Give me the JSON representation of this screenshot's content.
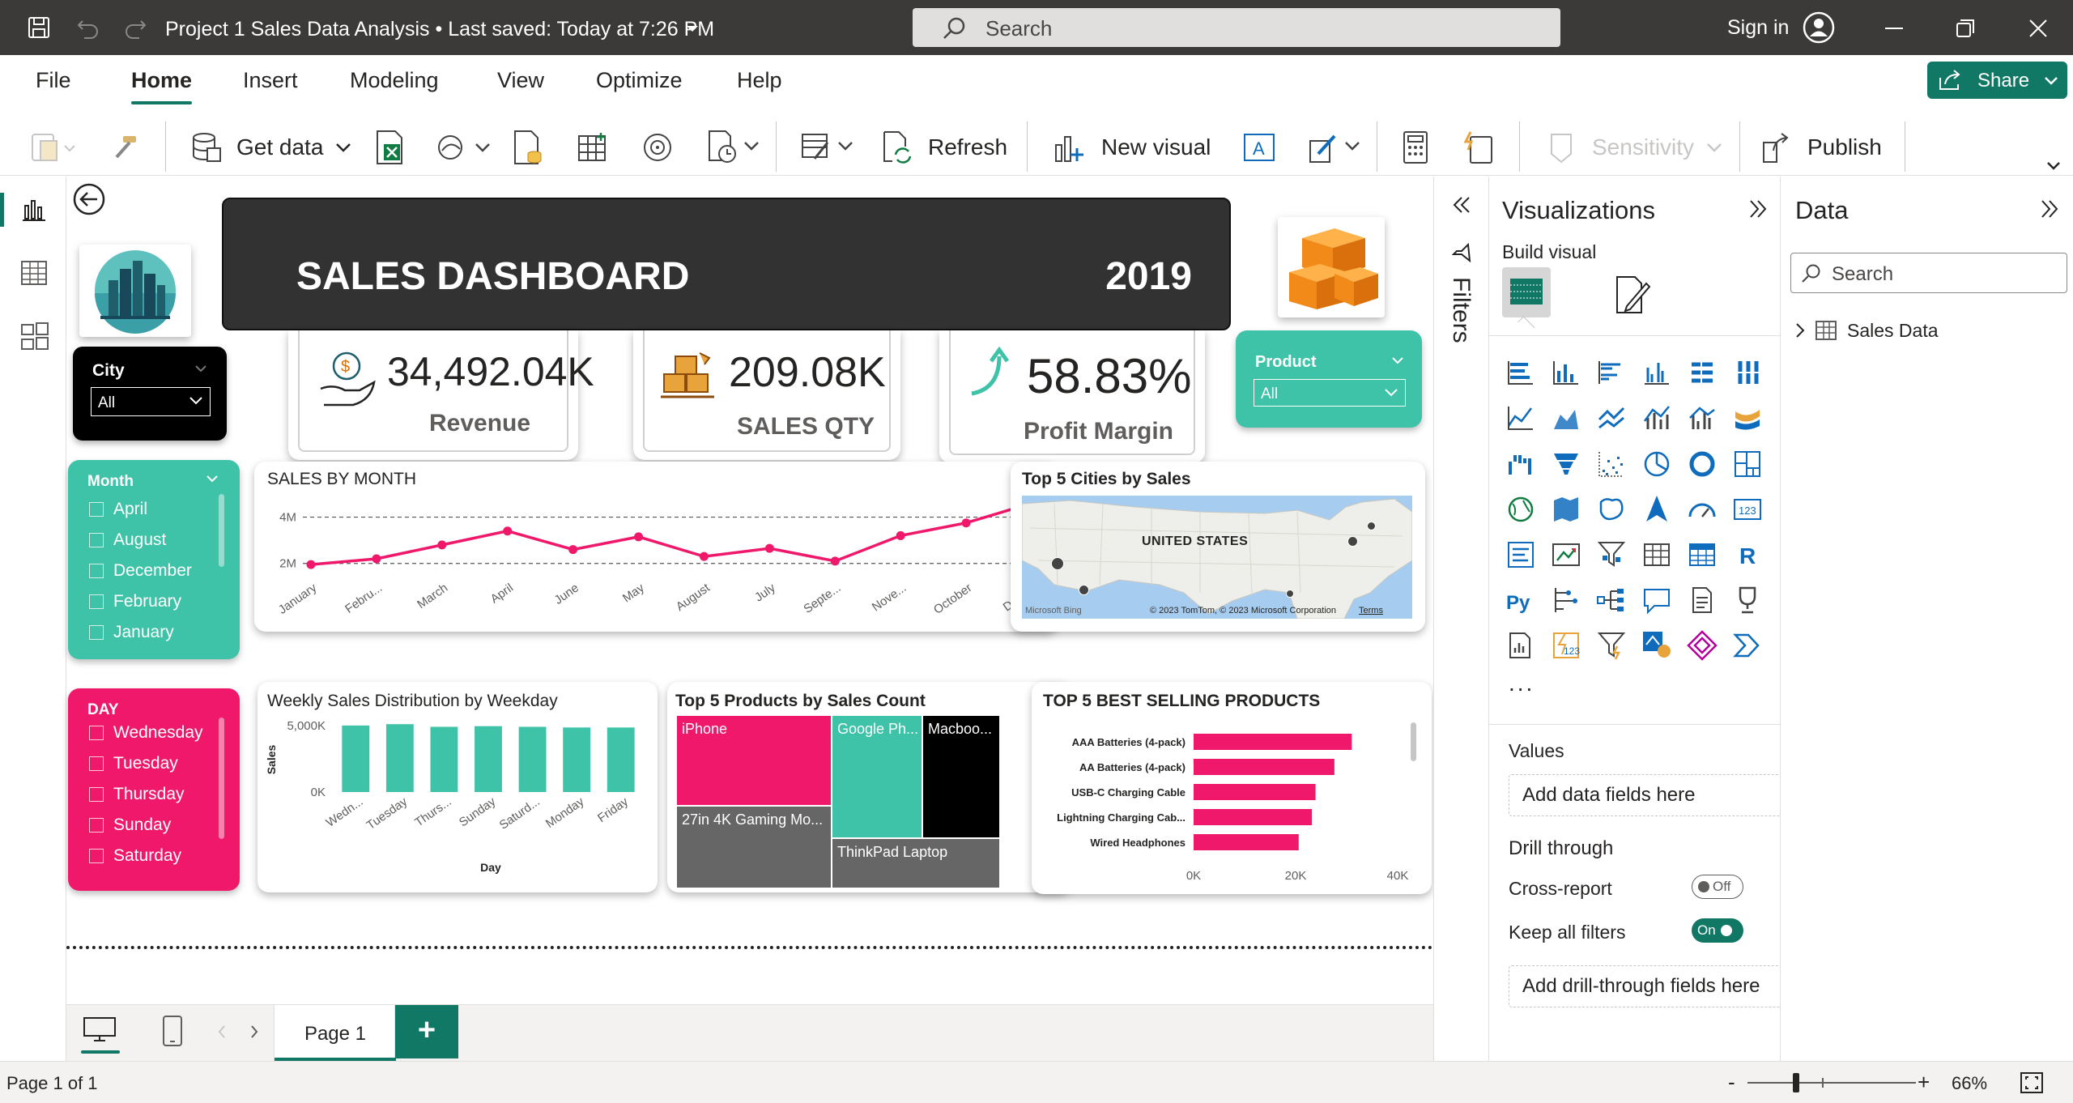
{
  "titlebar": {
    "title": "Project 1 Sales Data Analysis • Last saved: Today at 7:26 PM",
    "search_placeholder": "Search",
    "signin": "Sign in"
  },
  "menu": {
    "file": "File",
    "home": "Home",
    "insert": "Insert",
    "modeling": "Modeling",
    "view": "View",
    "optimize": "Optimize",
    "help": "Help",
    "share": "Share"
  },
  "ribbon": {
    "get_data": "Get data",
    "refresh": "Refresh",
    "new_visual": "New visual",
    "sensitivity": "Sensitivity",
    "publish": "Publish"
  },
  "dashboard": {
    "header_title": "SALES DASHBOARD",
    "header_year": "2019",
    "kpis": [
      {
        "value": "34,492.04K",
        "label": "Revenue"
      },
      {
        "value": "209.08K",
        "label": "SALES QTY"
      },
      {
        "value": "58.83%",
        "label": "Profit Margin"
      }
    ],
    "city_slicer": {
      "title": "City",
      "value": "All"
    },
    "product_slicer": {
      "title": "Product",
      "value": "All"
    },
    "month_slicer": {
      "title": "Month",
      "items": [
        "April",
        "August",
        "December",
        "February",
        "January"
      ]
    },
    "day_slicer": {
      "title": "DAY",
      "items": [
        "Wednesday",
        "Tuesday",
        "Thursday",
        "Sunday",
        "Saturday"
      ]
    },
    "map": {
      "title": "Top 5 Cities by Sales",
      "country_label": "UNITED STATES",
      "attribution": "© 2023 TomTom, © 2023 Microsoft Corporation",
      "terms": "Terms",
      "bing": "Microsoft Bing"
    },
    "treemap": {
      "title": "Top 5 Products by Sales Count",
      "items": [
        "iPhone",
        "Google Ph...",
        "Macboo...",
        "27in 4K Gaming Mo...",
        "ThinkPad Laptop"
      ]
    }
  },
  "chart_data": [
    {
      "type": "line",
      "title": "SALES BY MONTH",
      "categories": [
        "January",
        "Febru...",
        "March",
        "April",
        "June",
        "May",
        "August",
        "July",
        "Septe...",
        "Nove...",
        "October",
        "Dece..."
      ],
      "values": [
        1.95,
        2.2,
        2.8,
        3.4,
        2.6,
        3.15,
        2.3,
        2.65,
        2.1,
        3.2,
        3.75,
        4.6
      ],
      "ylim": [
        1.5,
        5
      ],
      "yticks": [
        "4M",
        "2M"
      ],
      "color": "#f0186b"
    },
    {
      "type": "bar",
      "title": "Weekly Sales Distribution by Weekday",
      "categories": [
        "Wedn...",
        "Tuesday",
        "Thurs...",
        "Sunday",
        "Saturd...",
        "Monday",
        "Friday"
      ],
      "values": [
        5000,
        5100,
        4900,
        4950,
        4900,
        4850,
        4850
      ],
      "ylim": [
        0,
        5600
      ],
      "yticks": [
        "5,000K",
        "0K"
      ],
      "xlabel": "Day",
      "ylabel": "Sales",
      "color": "#3ec2a8"
    },
    {
      "type": "bar",
      "title": "TOP 5 BEST SELLING PRODUCTS",
      "categories": [
        "AAA Batteries (4-pack)",
        "AA Batteries (4-pack)",
        "USB-C Charging Cable",
        "Lightning Charging Cab...",
        "Wired Headphones"
      ],
      "values": [
        31000,
        27600,
        23900,
        23200,
        20600
      ],
      "xlim": [
        0,
        40000
      ],
      "xticks": [
        "0K",
        "20K",
        "40K"
      ],
      "color": "#f0186b"
    }
  ],
  "visualizations": {
    "title": "Visualizations",
    "build_visual": "Build visual",
    "values": "Values",
    "add_data_fields": "Add data fields here",
    "drill_through": "Drill through",
    "cross_report": "Cross-report",
    "cross_report_state": "Off",
    "keep_all_filters": "Keep all filters",
    "keep_state": "On",
    "add_drill": "Add drill-through fields here",
    "more": "..."
  },
  "filters": {
    "label": "Filters"
  },
  "data_pane": {
    "title": "Data",
    "search_placeholder": "Search",
    "table": "Sales Data"
  },
  "pages": {
    "page1": "Page 1",
    "add": "+"
  },
  "status": {
    "page": "Page 1 of 1",
    "zoom": "66%",
    "minus": "-",
    "plus": "+"
  },
  "colors": {
    "accent": "#117865",
    "pink": "#f0186b",
    "teal": "#3ec2a8",
    "dark": "#3b3a39"
  }
}
